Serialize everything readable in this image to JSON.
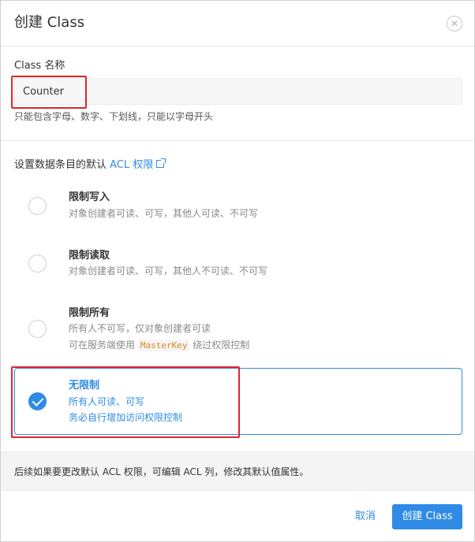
{
  "dialog": {
    "title": "创建 Class",
    "close_icon": "close-icon",
    "close_glyph": "✕"
  },
  "class_name": {
    "label": "Class 名称",
    "value": "Counter",
    "hint": "只能包含字母、数字、下划线，只能以字母开头"
  },
  "acl": {
    "heading_prefix": "设置数据条目的默认 ",
    "heading_link": "ACL 权限",
    "link_icon": "external-link-icon",
    "options": [
      {
        "title": "限制写入",
        "desc": [
          "对象创建者可读、可写，其他人可读、不可写"
        ],
        "selected": false
      },
      {
        "title": "限制读取",
        "desc": [
          "对象创建者可读、可写，其他人不可读、不可写"
        ],
        "selected": false
      },
      {
        "title": "限制所有",
        "desc": [
          "所有人不可写，仅对象创建者可读"
        ],
        "desc_line2_prefix": "可在服务端使用 ",
        "desc_line2_code": "MasterKey",
        "desc_line2_suffix": " 绕过权限控制",
        "selected": false
      },
      {
        "title": "无限制",
        "desc": [
          "所有人可读、可写",
          "务必自行增加访问权限控制"
        ],
        "selected": true
      }
    ]
  },
  "notice": "后续如果要更改默认 ACL 权限，可编辑 ACL 列，修改其默认值属性。",
  "footer": {
    "cancel_label": "取消",
    "create_label": "创建 Class"
  },
  "colors": {
    "accent": "#2f8be6",
    "annotation_red": "#e0252b",
    "code_text": "#d98a1c"
  }
}
